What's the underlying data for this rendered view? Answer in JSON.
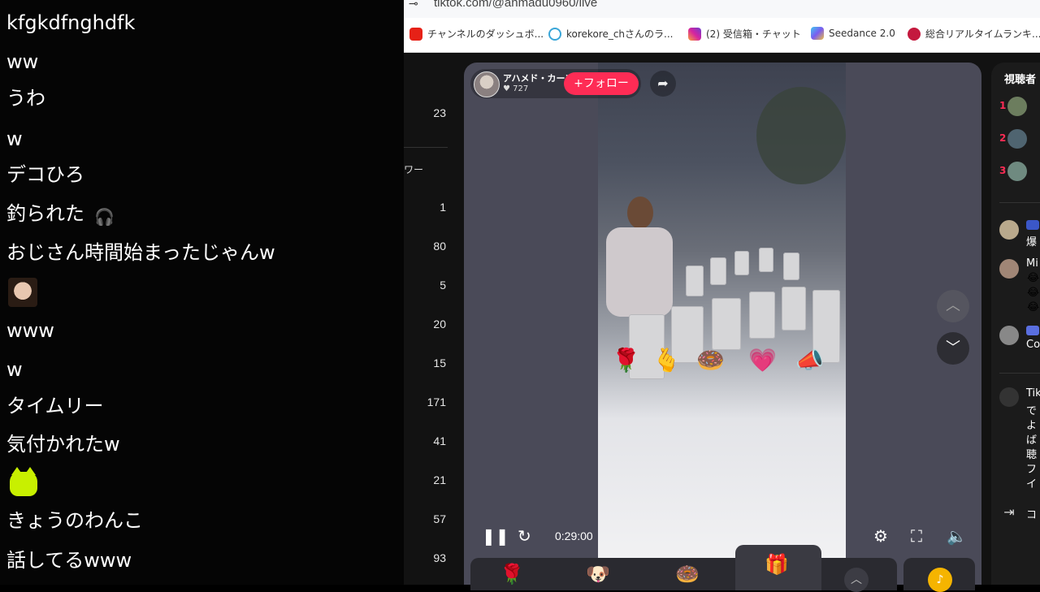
{
  "chat_overlay": {
    "messages": [
      "kfgkdfnghdfk",
      "ww",
      "うわ",
      "w",
      "デコひろ",
      "釣られた",
      "おじさん時間始まったじゃんw",
      "www",
      "w",
      "タイムリー",
      "気付かれたw",
      "きょうのわんこ",
      "話してるwww"
    ]
  },
  "browser": {
    "address": "tiktok.com/@ahmadu0960/live",
    "bookmarks": [
      "チャンネルのダッシュボ...",
      "korekore_chさんのラ...",
      "(2) 受信箱・チャット",
      "Seedance 2.0",
      "総合リアルタイムランキ..."
    ]
  },
  "left_list": {
    "top_number": "23",
    "follower_label": "ワー",
    "numbers": [
      "1",
      "80",
      "5",
      "20",
      "15",
      "171",
      "41",
      "21",
      "57",
      "93"
    ]
  },
  "live": {
    "streamer_name": "アハメド・カーン",
    "likes": "727",
    "follow_label": "+フォロー",
    "timer": "0:29:00"
  },
  "right_panel": {
    "title": "視聴者",
    "ranks": [
      "1",
      "2",
      "3"
    ],
    "comments": [
      "爆",
      "Mi",
      "Co",
      "Tik",
      "で",
      "よ",
      "ば",
      "聴",
      "フ",
      "イ",
      "コ"
    ]
  },
  "colors": {
    "follow": "#fe2c55",
    "background": "#121212",
    "player": "#4a4a58"
  }
}
